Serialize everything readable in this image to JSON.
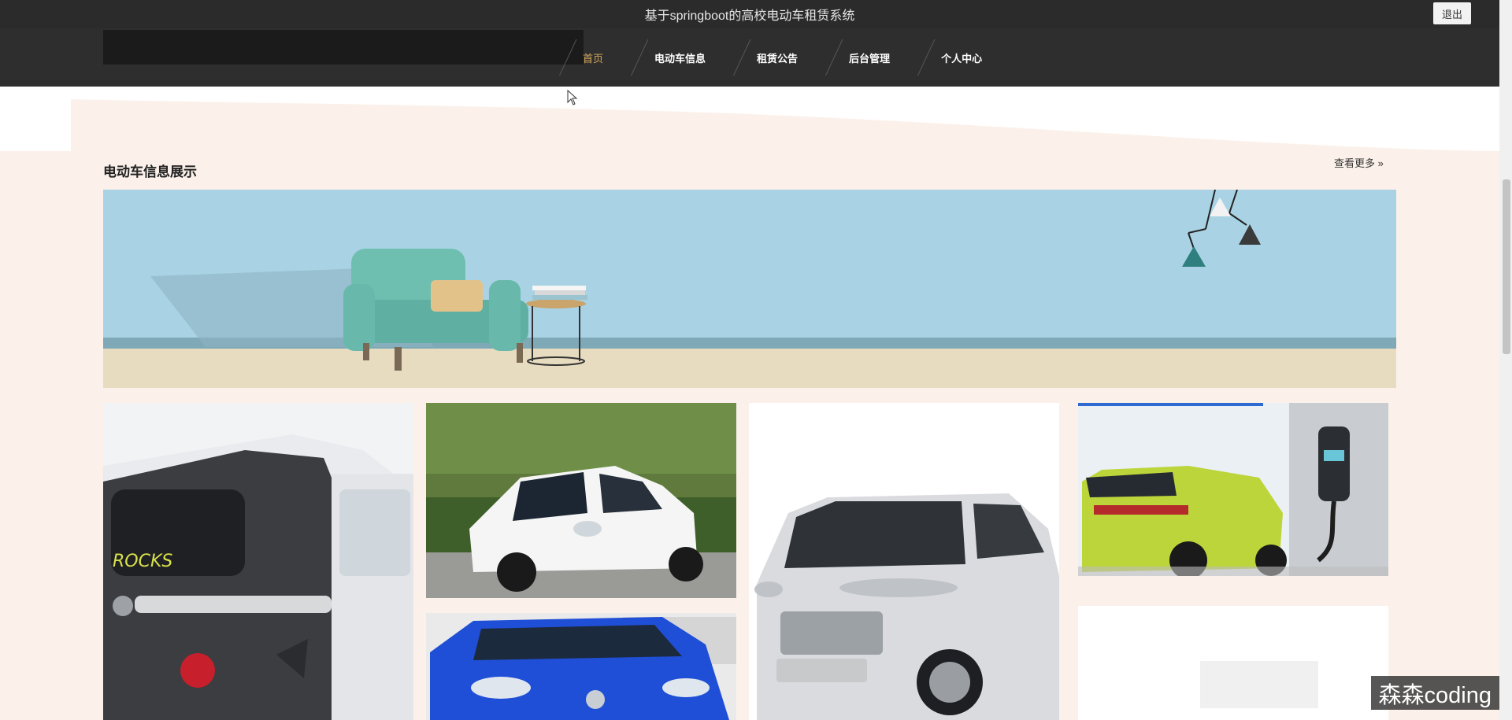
{
  "header": {
    "site_title": "基于springboot的高校电动车租赁系统",
    "logout_label": "退出"
  },
  "nav": {
    "items": [
      {
        "label": "首页",
        "active": true
      },
      {
        "label": "电动车信息",
        "active": false
      },
      {
        "label": "租赁公告",
        "active": false
      },
      {
        "label": "后台管理",
        "active": false
      },
      {
        "label": "个人中心",
        "active": false
      }
    ],
    "active_color": "#d6a85a"
  },
  "section": {
    "title": "电动车信息展示",
    "view_more": "查看更多 »"
  },
  "cards": [
    {
      "icon": "grey-opel-rocks-car-image"
    },
    {
      "icon": "white-mini-car-image"
    },
    {
      "icon": "blue-compact-car-image"
    },
    {
      "icon": "silver-ora-car-image"
    },
    {
      "icon": "lime-suv-charging-image"
    },
    {
      "icon": "blank-card"
    }
  ],
  "watermark": "森森coding",
  "colors": {
    "topbar": "#2b2b2b",
    "navbar": "#2e2e2e",
    "page_bg": "#fbf1ea",
    "banner_sky": "#a9d3e4"
  }
}
